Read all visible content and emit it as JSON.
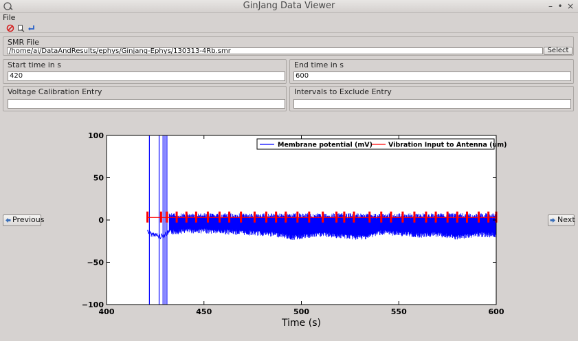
{
  "window": {
    "title": "GinJang Data Viewer"
  },
  "menu": {
    "file": "File"
  },
  "toolbar": {
    "stop_icon": "stop-icon",
    "export_icon": "export-icon",
    "return_icon": "return-icon"
  },
  "smr_group": {
    "label": "SMR File",
    "path": "/home/ai/DataAndResults/ephys/Ginjang-Ephys/130313-4Rb.smr",
    "select_label": "Select"
  },
  "start_group": {
    "label": "Start time in s",
    "value": "420"
  },
  "end_group": {
    "label": "End time in s",
    "value": "600"
  },
  "voltage_group": {
    "label": "Voltage Calibration Entry",
    "value": ""
  },
  "intervals_group": {
    "label": "Intervals to Exclude Entry",
    "value": ""
  },
  "nav": {
    "previous": "Previous",
    "next": "Next"
  },
  "chart_data": {
    "type": "line",
    "xlabel": "Time (s)",
    "ylabel": "",
    "xlim": [
      400,
      600
    ],
    "ylim": [
      -100,
      100
    ],
    "xticks": [
      "400",
      "450",
      "500",
      "550",
      "600"
    ],
    "yticks": [
      "100",
      "50",
      "0",
      "−50",
      "−100"
    ],
    "legend_position": "top-right",
    "series": [
      {
        "name": "Membrane potential (mV)",
        "color": "#0000ff",
        "spikes_x": [
          422,
          427,
          429,
          430,
          431
        ],
        "baseline": [
          [
            421,
            -10
          ],
          [
            423,
            -14
          ],
          [
            425,
            -14
          ],
          [
            427,
            -17
          ],
          [
            432,
            -12
          ],
          [
            440,
            -10
          ],
          [
            450,
            -10
          ],
          [
            460,
            -11
          ],
          [
            470,
            -12
          ],
          [
            480,
            -13
          ],
          [
            490,
            -15
          ],
          [
            495,
            -18
          ],
          [
            500,
            -17
          ],
          [
            510,
            -14
          ],
          [
            520,
            -16
          ],
          [
            530,
            -18
          ],
          [
            535,
            -16
          ],
          [
            540,
            -12
          ],
          [
            550,
            -13
          ],
          [
            560,
            -15
          ],
          [
            570,
            -14
          ],
          [
            575,
            -16
          ],
          [
            580,
            -18
          ],
          [
            590,
            -14
          ],
          [
            600,
            -15
          ]
        ],
        "band_top": 8
      },
      {
        "name": "Vibration Input to Antenna (um)",
        "color": "#ff0000",
        "level": 3,
        "pulses_x": [
          421,
          428,
          431,
          436,
          441,
          446,
          452,
          458,
          463,
          469,
          476,
          482,
          487,
          492,
          498,
          504,
          511,
          518,
          522,
          527,
          535,
          541,
          546,
          552,
          558,
          564,
          569,
          575,
          580,
          585,
          591,
          596,
          600
        ]
      }
    ]
  }
}
